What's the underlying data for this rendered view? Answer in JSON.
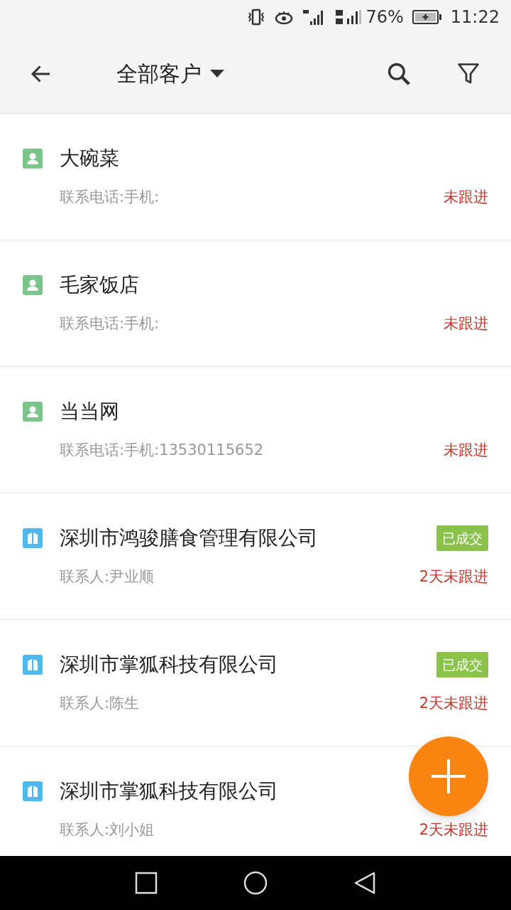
{
  "status_bar": {
    "battery": "76%",
    "time": "11:22"
  },
  "toolbar": {
    "title": "全部客户"
  },
  "customers": [
    {
      "kind": "person",
      "name": "大碗菜",
      "contact": "联系电话:手机:",
      "follow": "未跟进"
    },
    {
      "kind": "person",
      "name": "毛家饭店",
      "contact": "联系电话:手机:",
      "follow": "未跟进"
    },
    {
      "kind": "person",
      "name": "当当网",
      "contact": "联系电话:手机:13530115652",
      "follow": "未跟进"
    },
    {
      "kind": "company",
      "name": "深圳市鸿骏膳食管理有限公司",
      "badge": "已成交",
      "contact": "联系人:尹业顺",
      "follow": "2天未跟进"
    },
    {
      "kind": "company",
      "name": "深圳市掌狐科技有限公司",
      "badge": "已成交",
      "contact": "联系人:陈生",
      "follow": "2天未跟进"
    },
    {
      "kind": "company",
      "name": "深圳市掌狐科技有限公司",
      "contact": "联系人:刘小姐",
      "follow": "2天未跟进"
    }
  ]
}
